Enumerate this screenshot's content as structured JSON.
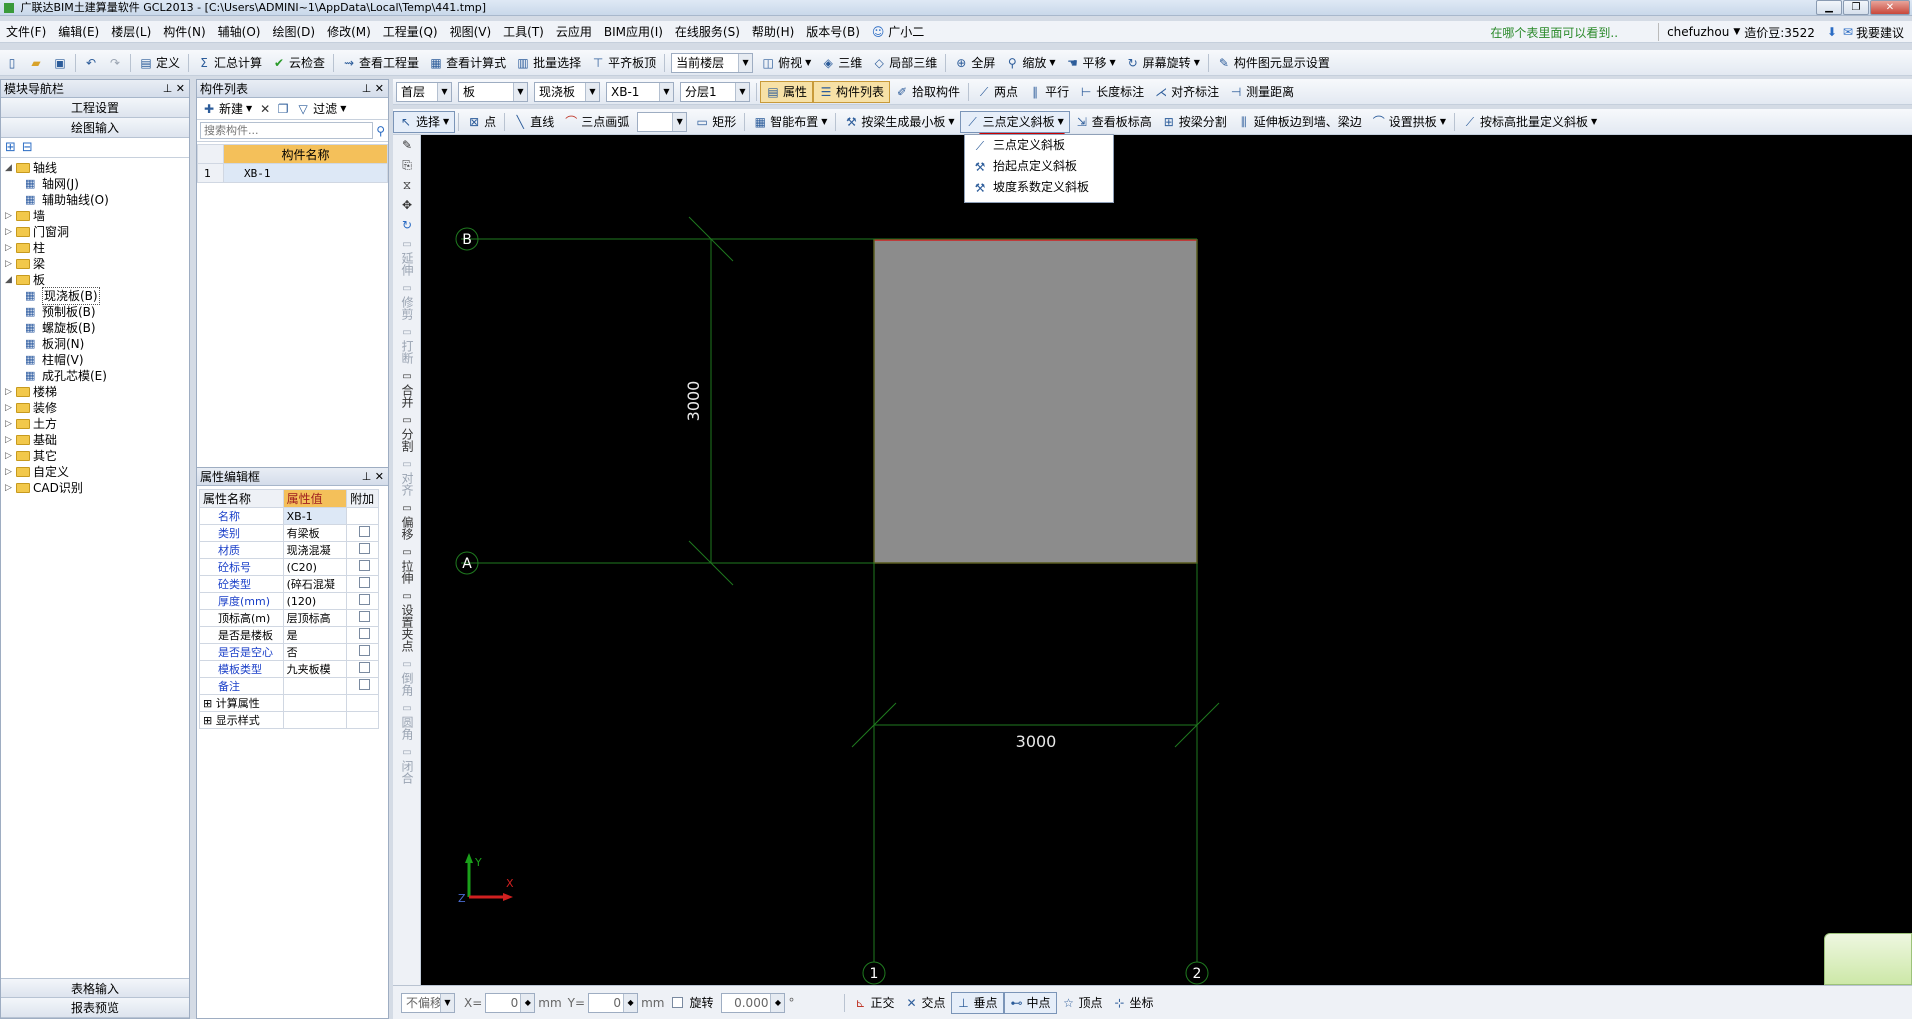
{
  "window": {
    "title": "广联达BIM土建算量软件 GCL2013 - [C:\\Users\\ADMINI~1\\AppData\\Local\\Temp\\441.tmp]"
  },
  "menu": {
    "items": [
      "文件(F)",
      "编辑(E)",
      "楼层(L)",
      "构件(N)",
      "辅轴(O)",
      "绘图(D)",
      "修改(M)",
      "工程量(Q)",
      "视图(V)",
      "工具(T)",
      "云应用",
      "BIM应用(I)",
      "在线服务(S)",
      "帮助(H)",
      "版本号(B)",
      "广小二"
    ],
    "hint": "在哪个表里面可以看到..",
    "user": "chefuzhou",
    "beans": "造价豆:3522",
    "suggest": "我要建议"
  },
  "toolbar1": {
    "define": "定义",
    "sum": "汇总计算",
    "cloud_check": "云检查",
    "view_qty": "查看工程量",
    "view_formula": "查看计算式",
    "batch_select": "批量选择",
    "align_top": "平齐板顶",
    "floor_combo": "当前楼层",
    "top_view": "俯视",
    "threed": "三维",
    "local3d": "局部三维",
    "fullscreen": "全屏",
    "zoom": "缩放",
    "pan": "平移",
    "rotate": "屏幕旋转",
    "display_settings": "构件图元显示设置"
  },
  "toolbar2": {
    "floor": "首层",
    "category": "板",
    "type": "现浇板",
    "name": "XB-1",
    "layer": "分层1",
    "props": "属性",
    "comp_list": "构件列表",
    "pick": "拾取构件",
    "two_points": "两点",
    "parallel": "平行",
    "length_mark": "长度标注",
    "align_mark": "对齐标注",
    "measure": "测量距离"
  },
  "toolbar3": {
    "select": "选择",
    "point": "点",
    "line": "直线",
    "arc": "三点画弧",
    "rect": "矩形",
    "smart": "智能布置",
    "beam_min": "按梁生成最小板",
    "three_point_slope": "三点定义斜板",
    "view_elev": "查看板标高",
    "beam_split": "按梁分割",
    "extend_to_wall": "延伸板边到墙、梁边",
    "arch": "设置拱板",
    "batch_elev": "按标高批量定义斜板"
  },
  "dropdown": {
    "items": [
      "三点定义斜板",
      "抬起点定义斜板",
      "坡度系数定义斜板"
    ]
  },
  "nav": {
    "title": "模块导航栏",
    "project_settings": "工程设置",
    "drawing_input": "绘图输入",
    "table_input": "表格输入",
    "report_preview": "报表预览",
    "tree": [
      {
        "label": "轴线",
        "expanded": true,
        "level": 0
      },
      {
        "label": "轴网(J)",
        "level": 1
      },
      {
        "label": "辅助轴线(O)",
        "level": 1
      },
      {
        "label": "墙",
        "level": 0
      },
      {
        "label": "门窗洞",
        "level": 0
      },
      {
        "label": "柱",
        "level": 0
      },
      {
        "label": "梁",
        "level": 0
      },
      {
        "label": "板",
        "expanded": true,
        "level": 0
      },
      {
        "label": "现浇板(B)",
        "level": 1,
        "selected": true
      },
      {
        "label": "预制板(B)",
        "level": 1
      },
      {
        "label": "螺旋板(B)",
        "level": 1
      },
      {
        "label": "板洞(N)",
        "level": 1
      },
      {
        "label": "柱帽(V)",
        "level": 1
      },
      {
        "label": "成孔芯模(E)",
        "level": 1
      },
      {
        "label": "楼梯",
        "level": 0
      },
      {
        "label": "装修",
        "level": 0
      },
      {
        "label": "土方",
        "level": 0
      },
      {
        "label": "基础",
        "level": 0
      },
      {
        "label": "其它",
        "level": 0
      },
      {
        "label": "自定义",
        "level": 0
      },
      {
        "label": "CAD识别",
        "level": 0
      }
    ]
  },
  "comp_list": {
    "title": "构件列表",
    "new": "新建",
    "filter": "过滤",
    "search_placeholder": "搜索构件...",
    "header": "构件名称",
    "rows": [
      {
        "index": "1",
        "name": "XB-1"
      }
    ]
  },
  "props": {
    "title": "属性编辑框",
    "headers": [
      "属性名称",
      "属性值",
      "附加"
    ],
    "rows": [
      {
        "name": "名称",
        "value": "XB-1",
        "blue": true,
        "check": false
      },
      {
        "name": "类别",
        "value": "有梁板",
        "blue": true,
        "check": true
      },
      {
        "name": "材质",
        "value": "现浇混凝",
        "blue": true,
        "check": true
      },
      {
        "name": "砼标号",
        "value": "(C20)",
        "blue": true,
        "check": true
      },
      {
        "name": "砼类型",
        "value": "(碎石混凝",
        "blue": true,
        "check": true
      },
      {
        "name": "厚度(mm)",
        "value": "(120)",
        "blue": true,
        "check": true
      },
      {
        "name": "顶标高(m)",
        "value": "层顶标高",
        "blue": false,
        "check": true
      },
      {
        "name": "是否是楼板",
        "value": "是",
        "blue": false,
        "check": true
      },
      {
        "name": "是否是空心",
        "value": "否",
        "blue": true,
        "check": true
      },
      {
        "name": "模板类型",
        "value": "九夹板模",
        "blue": true,
        "check": true
      },
      {
        "name": "备注",
        "value": "",
        "blue": true,
        "check": true
      }
    ],
    "groups": [
      "计算属性",
      "显示样式"
    ]
  },
  "vtools": [
    "延伸",
    "修剪",
    "打断",
    "合并",
    "分割",
    "对齐",
    "偏移",
    "拉伸",
    "设置夹点",
    "倒角",
    "圆角",
    "闭合"
  ],
  "drawing": {
    "axis_labels": {
      "a": "A",
      "b": "B",
      "one": "1",
      "two": "2"
    },
    "dim_vertical": "3000",
    "dim_horizontal": "3000",
    "coord_y": "Y",
    "coord_x": "X",
    "coord_z": "Z"
  },
  "status": {
    "offset": "不偏移",
    "x_label": "X=",
    "x_value": "0",
    "mm1": "mm",
    "y_label": "Y=",
    "y_value": "0",
    "mm2": "mm",
    "rotate": "旋转",
    "angle": "0.000",
    "ortho": "正交",
    "intersection": "交点",
    "perp": "垂点",
    "mid": "中点",
    "vertex": "顶点",
    "coords": "坐标"
  },
  "colors": {
    "accent_red": "#d00000",
    "grid_green": "#1f7a1f",
    "slab_gray": "#8c8c8c"
  }
}
